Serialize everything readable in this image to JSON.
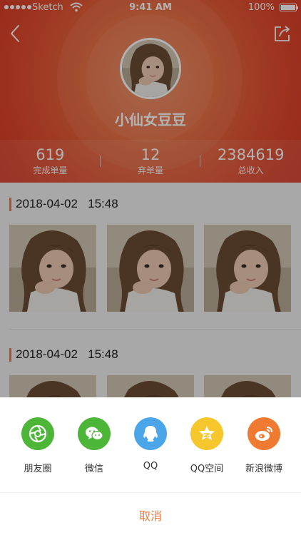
{
  "status_bar": {
    "carrier": "Sketch",
    "time": "9:41 AM",
    "battery": "100%"
  },
  "profile": {
    "name": "小仙女豆豆"
  },
  "stats": [
    {
      "value": "619",
      "label": "完成单量"
    },
    {
      "value": "12",
      "label": "弃单量"
    },
    {
      "value": "2384619",
      "label": "总收入"
    }
  ],
  "records": [
    {
      "date": "2018-04-02",
      "time": "15:48"
    },
    {
      "date": "2018-04-02",
      "time": "15:48"
    }
  ],
  "share_sheet": {
    "options": [
      {
        "label": "朋友圈",
        "icon": "moments-icon",
        "color": "#4db538"
      },
      {
        "label": "微信",
        "icon": "wechat-icon",
        "color": "#4db538"
      },
      {
        "label": "QQ",
        "icon": "qq-icon",
        "color": "#4aa6e8"
      },
      {
        "label": "QQ空间",
        "icon": "qzone-icon",
        "color": "#f5c72d"
      },
      {
        "label": "新浪微博",
        "icon": "weibo-icon",
        "color": "#f07a31"
      }
    ],
    "cancel_label": "取消"
  },
  "colors": {
    "accent": "#ef7838",
    "header": "#e4552f"
  }
}
